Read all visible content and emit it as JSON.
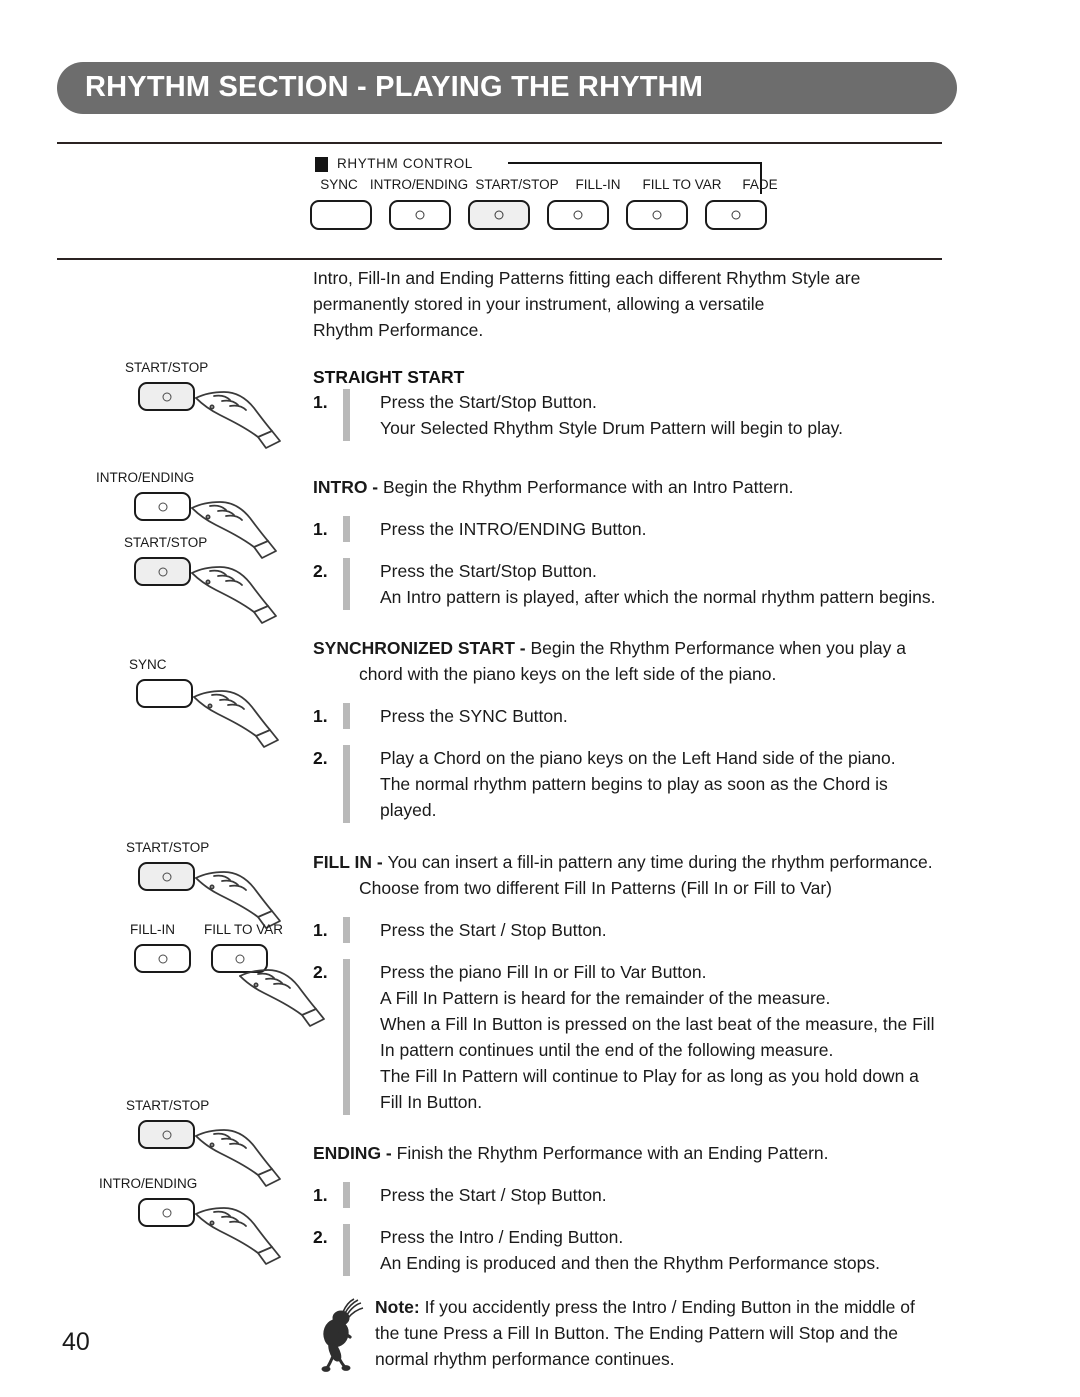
{
  "header": {
    "title": "RHYTHM SECTION - PLAYING THE RHYTHM"
  },
  "rhythm_control_panel": {
    "badge_label": "RHYTHM  CONTROL",
    "buttons": [
      {
        "label": "SYNC",
        "has_led": false,
        "active": false
      },
      {
        "label": "INTRO/ENDING",
        "has_led": true,
        "active": false
      },
      {
        "label": "START/STOP",
        "has_led": true,
        "active": true
      },
      {
        "label": "FILL-IN",
        "has_led": true,
        "active": false
      },
      {
        "label": "FILL TO VAR",
        "has_led": true,
        "active": false
      },
      {
        "label": "FADE",
        "has_led": true,
        "active": false
      }
    ]
  },
  "intro_paragraph": [
    "Intro, Fill-In and Ending Patterns fitting each different Rhythm Style are",
    "permanently stored in your instrument, allowing a versatile",
    "Rhythm Performance."
  ],
  "sections": {
    "straight_start": {
      "heading": "STRAIGHT START",
      "steps": [
        {
          "num": "1.",
          "lines": [
            "Press the Start/Stop Button.",
            "Your Selected Rhythm Style Drum Pattern will begin to play."
          ]
        }
      ]
    },
    "intro": {
      "term": "INTRO - ",
      "lead": "Begin the Rhythm Performance with an Intro Pattern.",
      "steps": [
        {
          "num": "1.",
          "lines": [
            "Press the INTRO/ENDING Button."
          ]
        },
        {
          "num": "2.",
          "lines": [
            "Press the Start/Stop Button.",
            "An Intro pattern is played, after which the normal rhythm pattern begins."
          ]
        }
      ]
    },
    "synchronized_start": {
      "term": "SYNCHRONIZED START - ",
      "lead": "Begin the Rhythm Performance when you play a",
      "lead_cont": "chord with the piano keys on the left side of the piano.",
      "steps": [
        {
          "num": "1.",
          "lines": [
            "Press the SYNC Button."
          ]
        },
        {
          "num": "2.",
          "lines": [
            "Play a Chord on the piano keys on the Left Hand side of the piano.",
            "The normal rhythm pattern begins to play as soon as the Chord is",
            "played."
          ]
        }
      ]
    },
    "fill_in": {
      "term": "FILL IN - ",
      "lead": " You can insert a fill-in pattern any time during the rhythm performance.",
      "lead_cont": "Choose from two different Fill In Patterns (Fill In or Fill to Var)",
      "steps": [
        {
          "num": "1.",
          "lines": [
            "Press the Start / Stop Button."
          ]
        },
        {
          "num": "2.",
          "lines": [
            "Press the piano Fill In or Fill to Var  Button.",
            "A Fill In Pattern is heard for the remainder of the measure.",
            "When a Fill In Button is pressed on the last beat of the measure, the Fill",
            "In pattern continues until the end of the following measure.",
            "The Fill In Pattern will continue to Play for as long as you hold down a",
            "Fill In Button."
          ]
        }
      ]
    },
    "ending": {
      "term": "ENDING - ",
      "lead": "Finish the Rhythm Performance with an Ending Pattern.",
      "steps": [
        {
          "num": "1.",
          "lines": [
            "Press the Start / Stop Button."
          ]
        },
        {
          "num": "2.",
          "lines": [
            "Press the Intro / Ending Button.",
            "An Ending is produced and then the Rhythm Performance stops."
          ]
        }
      ]
    }
  },
  "note": {
    "label": "Note:",
    "lines": [
      " If you accidently press the Intro / Ending Button in the middle of",
      "the tune Press a Fill In Button.  The Ending Pattern will Stop and the",
      "normal rhythm performance continues."
    ]
  },
  "figures": {
    "straight_start": [
      {
        "label": "START/STOP",
        "shaded": true,
        "has_led": true
      }
    ],
    "intro": [
      {
        "label": "INTRO/ENDING",
        "shaded": false,
        "has_led": true
      },
      {
        "label": "START/STOP",
        "shaded": true,
        "has_led": true
      }
    ],
    "sync": [
      {
        "label": "SYNC",
        "shaded": false,
        "has_led": false
      }
    ],
    "fill_in": [
      {
        "label": "START/STOP",
        "shaded": true,
        "has_led": true
      },
      {
        "label": "FILL-IN",
        "shaded": false,
        "has_led": true
      },
      {
        "label": "FILL TO VAR",
        "shaded": false,
        "has_led": true
      }
    ],
    "ending": [
      {
        "label": "START/STOP",
        "shaded": true,
        "has_led": true
      },
      {
        "label": "INTRO/ENDING",
        "shaded": false,
        "has_led": true
      }
    ]
  },
  "footer": {
    "page_number": "40"
  },
  "colors": {
    "header_banner": "#6d6d6d",
    "rule": "#2b2322",
    "step_bar": "#b9b9b9",
    "button_active_fill": "#efefef"
  }
}
